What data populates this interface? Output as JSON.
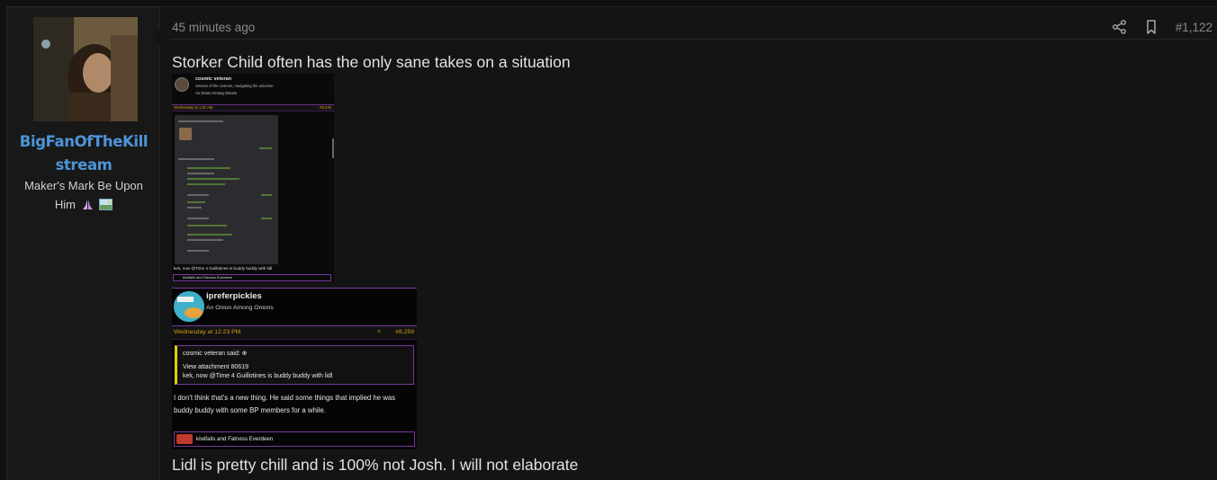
{
  "user": {
    "name_line1": "BigFanOfTheKill",
    "name_line2": "stream",
    "title": "Maker's Mark Be Upon Him",
    "emoji": [
      "praying-hands-icon",
      "picture-icon"
    ]
  },
  "post": {
    "time": "45 minutes ago",
    "number": "#1,122",
    "text_top": "Storker Child often has the only sane takes on a situation",
    "text_bottom": "Lidl is pretty chill and is 100% not Josh. I will not elaborate"
  },
  "embed1": {
    "username": "cosmic veteran",
    "subtitle": "veteran of the cosmos, navigating the universe",
    "rank": "An Onion Among Onions",
    "date": "Wednesday at 1:21 AM",
    "number": "#8,240",
    "footer": "kek, now @Time 4 Guillotines is buddy buddy with lidl",
    "reactions": "kiwifails and Fatness Everdeen"
  },
  "embed2": {
    "username": "ipreferpickles",
    "rank": "An Onion Among Onions",
    "date": "Wednesday at 12:23 PM",
    "number": "#8,259",
    "quote_author": "cosmic veteran said: ⊕",
    "quote_line1": "View attachment 80619",
    "quote_line2": "kek, now @Time 4 Guillotines is buddy buddy with lidl",
    "body": "I don't think that's a new thing. He said some things that implied he was buddy buddy with some BP members for a while.",
    "reactions": "kiwifails and Fatness Everdeen"
  },
  "colors": {
    "username": "#4d95d9",
    "accent_purple": "#7a35a0",
    "date_gold": "#d4a017"
  }
}
